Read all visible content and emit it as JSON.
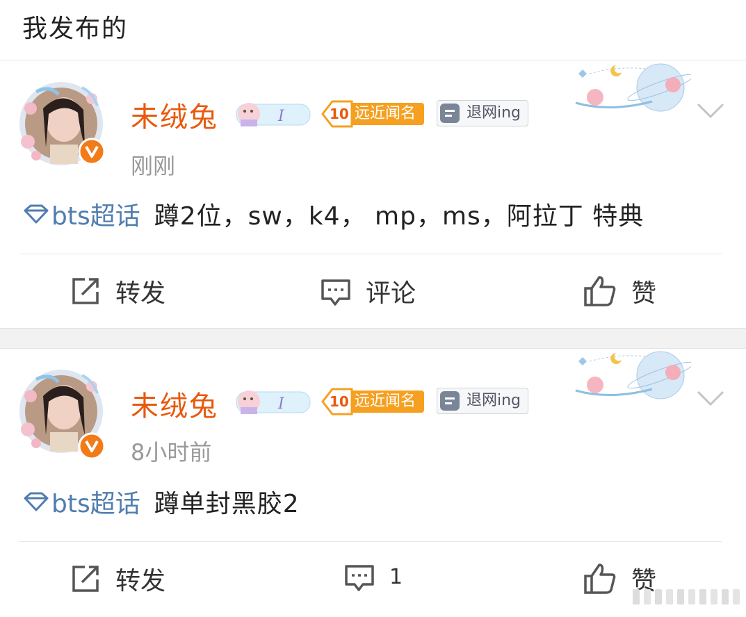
{
  "header": {
    "title": "我发布的"
  },
  "posts": [
    {
      "username": "未绒兔",
      "level_badge": {
        "number": "10",
        "label": "远近闻名"
      },
      "status_badge": "退网ing",
      "time": "刚刚",
      "topic": "bts超话",
      "text": "蹲2位，sw，k4， mp，ms，阿拉丁 特典",
      "actions": {
        "repost": "转发",
        "comment": "评论",
        "like": "赞"
      }
    },
    {
      "username": "未绒兔",
      "level_badge": {
        "number": "10",
        "label": "远近闻名"
      },
      "status_badge": "退网ing",
      "time": "8小时前",
      "topic": "bts超话",
      "text": "蹲单封黑胶2",
      "actions": {
        "repost": "转发",
        "comment": "1",
        "like": "赞"
      }
    }
  ],
  "colors": {
    "username": "#e8590c",
    "topic": "#507daf",
    "level_badge": "#f5a020",
    "verified": "#f27b18"
  },
  "icons": [
    "repost-icon",
    "comment-icon",
    "like-icon",
    "chevron-down-icon",
    "diamond-icon",
    "verified-icon"
  ]
}
